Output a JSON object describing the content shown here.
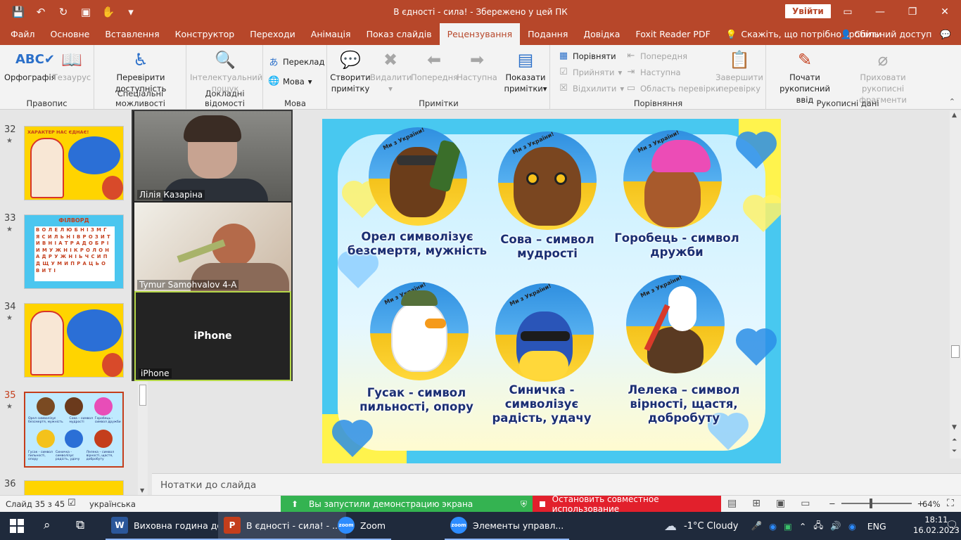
{
  "titlebar": {
    "doc_title": "В єдності - сила!  -  Збережено у цей ПК",
    "signin": "Увійти",
    "minimize": "—",
    "restore": "❐",
    "close": "✕",
    "qa_save": "💾",
    "qa_undo": "↶",
    "qa_redo": "↻",
    "qa_present": "▣",
    "qa_touch": "✋",
    "qa_more": "▾"
  },
  "tabs": [
    {
      "label": "Файл"
    },
    {
      "label": "Основне"
    },
    {
      "label": "Вставлення"
    },
    {
      "label": "Конструктор"
    },
    {
      "label": "Переходи"
    },
    {
      "label": "Анімація"
    },
    {
      "label": "Показ слайдів"
    },
    {
      "label": "Рецензування"
    },
    {
      "label": "Подання"
    },
    {
      "label": "Довідка"
    },
    {
      "label": "Foxit Reader PDF"
    }
  ],
  "tell_me": "Скажіть, що потрібно зробити",
  "share": "Спільний доступ",
  "ribbon": {
    "spelling": "Орфографія",
    "thesaurus": "Тезаурус",
    "group_spelling": "Правопис",
    "check_access_1": "Перевірити",
    "check_access_2": "доступність",
    "group_access": "Спеціальні можливості",
    "smart_lookup_1": "Інтелектуальний",
    "smart_lookup_2": "пошук",
    "group_insights": "Докладні відомості",
    "translate": "Переклад",
    "language": "Мова",
    "group_language": "Мова",
    "new_comment_1": "Створити",
    "new_comment_2": "примітку",
    "delete": "Видалити",
    "previous": "Попередня",
    "next": "Наступна",
    "show_comments_1": "Показати",
    "show_comments_2": "примітки",
    "group_comments": "Примітки",
    "compare": "Порівняти",
    "accept": "Прийняти",
    "reject": "Відхилити",
    "prev_change": "Попередня",
    "next_change": "Наступна",
    "reviewing_pane": "Область перевірки",
    "end_review_1": "Завершити",
    "end_review_2": "перевірку",
    "group_compare": "Порівняння",
    "start_ink_1": "Почати",
    "start_ink_2": "рукописний ввід",
    "hide_ink_1": "Приховати рукописні",
    "hide_ink_2": "фрагменти",
    "group_ink": "Рукописні дані"
  },
  "thumbnails": [
    {
      "num": "32",
      "star": "★"
    },
    {
      "num": "33",
      "star": "★",
      "title": "ФІЛВОРД"
    },
    {
      "num": "34",
      "star": "★"
    },
    {
      "num": "35",
      "star": "★"
    },
    {
      "num": "36",
      "star": ""
    }
  ],
  "thumb32_title": "ХАРАКТЕР НАС ЄДНАЄ!",
  "filword_letters": "ВОЛЕЛЮБНІЗМГЯСИЛЬНІВРОЗИТИВНІАТРАДОБРІИМУЖНІКРОЛОНАДРУЖНІЬЧСИПДЩУМИПРАЦЬОВИТІ",
  "gallery": [
    {
      "name": "Лілія Казаріна"
    },
    {
      "name": "Tymur Samohvalov 4-А"
    },
    {
      "name": "iPhone",
      "big": "iPhone"
    }
  ],
  "slide": {
    "captions": [
      "Орел символізує безсмертя, мужність",
      "Сова – символ мудрості",
      "Горобець - символ дружби",
      "Гусак - символ пильності, опору",
      "Синичка - символізує радість, удачу",
      "Лелека – символ вірності, щастя, добробуту"
    ],
    "badge": "Ми з України!"
  },
  "notes_placeholder": "Нотатки до слайда",
  "status": {
    "slide_count": "Слайд 35 з 45",
    "language": "українська",
    "screen_share": "Вы запустили демонстрацию экрана",
    "stop_share": "Остановить совместное использование",
    "zoom_pct": "64%",
    "zoom_minus": "−",
    "zoom_plus": "+"
  },
  "taskbar": {
    "tasks": [
      {
        "label": "Виховна година до..."
      },
      {
        "label": "В єдності - сила! - ..."
      },
      {
        "label": "Zoom"
      },
      {
        "label": "Элементы управл..."
      }
    ],
    "weather": "-1°C  Cloudy",
    "lang": "ENG",
    "time": "18:11",
    "date": "16.02.2023"
  },
  "colors": {
    "accent": "#b7472a",
    "slide_text": "#1b2f73",
    "share_green": "#34b351",
    "share_red": "#e2202c",
    "taskbar": "#1f2a3c"
  }
}
